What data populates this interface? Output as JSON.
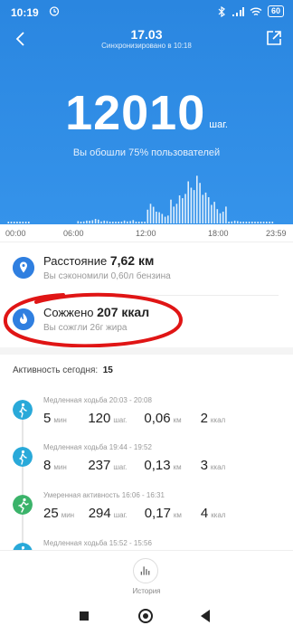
{
  "status_bar": {
    "time": "10:19",
    "battery": "60"
  },
  "header": {
    "title": "17.03",
    "subtitle": "Синхронизировано в 10:18"
  },
  "steps": {
    "value": "12010",
    "unit": "шаг.",
    "hint": "Вы обошли 75% пользователей"
  },
  "chart_data": {
    "type": "bar",
    "x_ticks": [
      "00:00",
      "06:00",
      "12:00",
      "18:00",
      "23:59"
    ],
    "hourly_activity": [
      0.02,
      0.01,
      0.0,
      0.0,
      0.0,
      0.0,
      0.05,
      0.08,
      0.05,
      0.03,
      0.06,
      0.02,
      0.35,
      0.2,
      0.5,
      0.75,
      0.85,
      0.55,
      0.3,
      0.05,
      0.03,
      0.02,
      0.01,
      0.0
    ]
  },
  "stats": {
    "distance": {
      "label": "Расстояние",
      "value": "7,62 км",
      "sub": "Вы сэкономили 0,60л бензина"
    },
    "burned": {
      "label": "Сожжено",
      "value": "207 ккал",
      "sub": "Вы сожгли 26г жира"
    }
  },
  "activity": {
    "title": "Активность сегодня:",
    "count": "15",
    "items": [
      {
        "label": "Медленная ходьба 20:03 - 20:08",
        "minutes": "5",
        "steps": "120",
        "km": "0,06",
        "kcal": "2",
        "color": "#29a9d9"
      },
      {
        "label": "Медленная ходьба 19:44 - 19:52",
        "minutes": "8",
        "steps": "237",
        "km": "0,13",
        "kcal": "3",
        "color": "#29a9d9"
      },
      {
        "label": "Умеренная активность 16:06 - 16:31",
        "minutes": "25",
        "steps": "294",
        "km": "0,17",
        "kcal": "4",
        "color": "#3bb36a"
      },
      {
        "label": "Медленная ходьба 15:52 - 15:56",
        "minutes": "",
        "steps": "",
        "km": "",
        "kcal": "",
        "color": "#29a9d9"
      }
    ],
    "units": {
      "min": "мин",
      "steps": "шаг.",
      "km": "км",
      "kcal": "ккал"
    }
  },
  "bottom_nav": {
    "history": "История"
  },
  "colors": {
    "hero": "#2a86e0",
    "accent": "#2f7fe0",
    "scribble": "#e01515"
  }
}
